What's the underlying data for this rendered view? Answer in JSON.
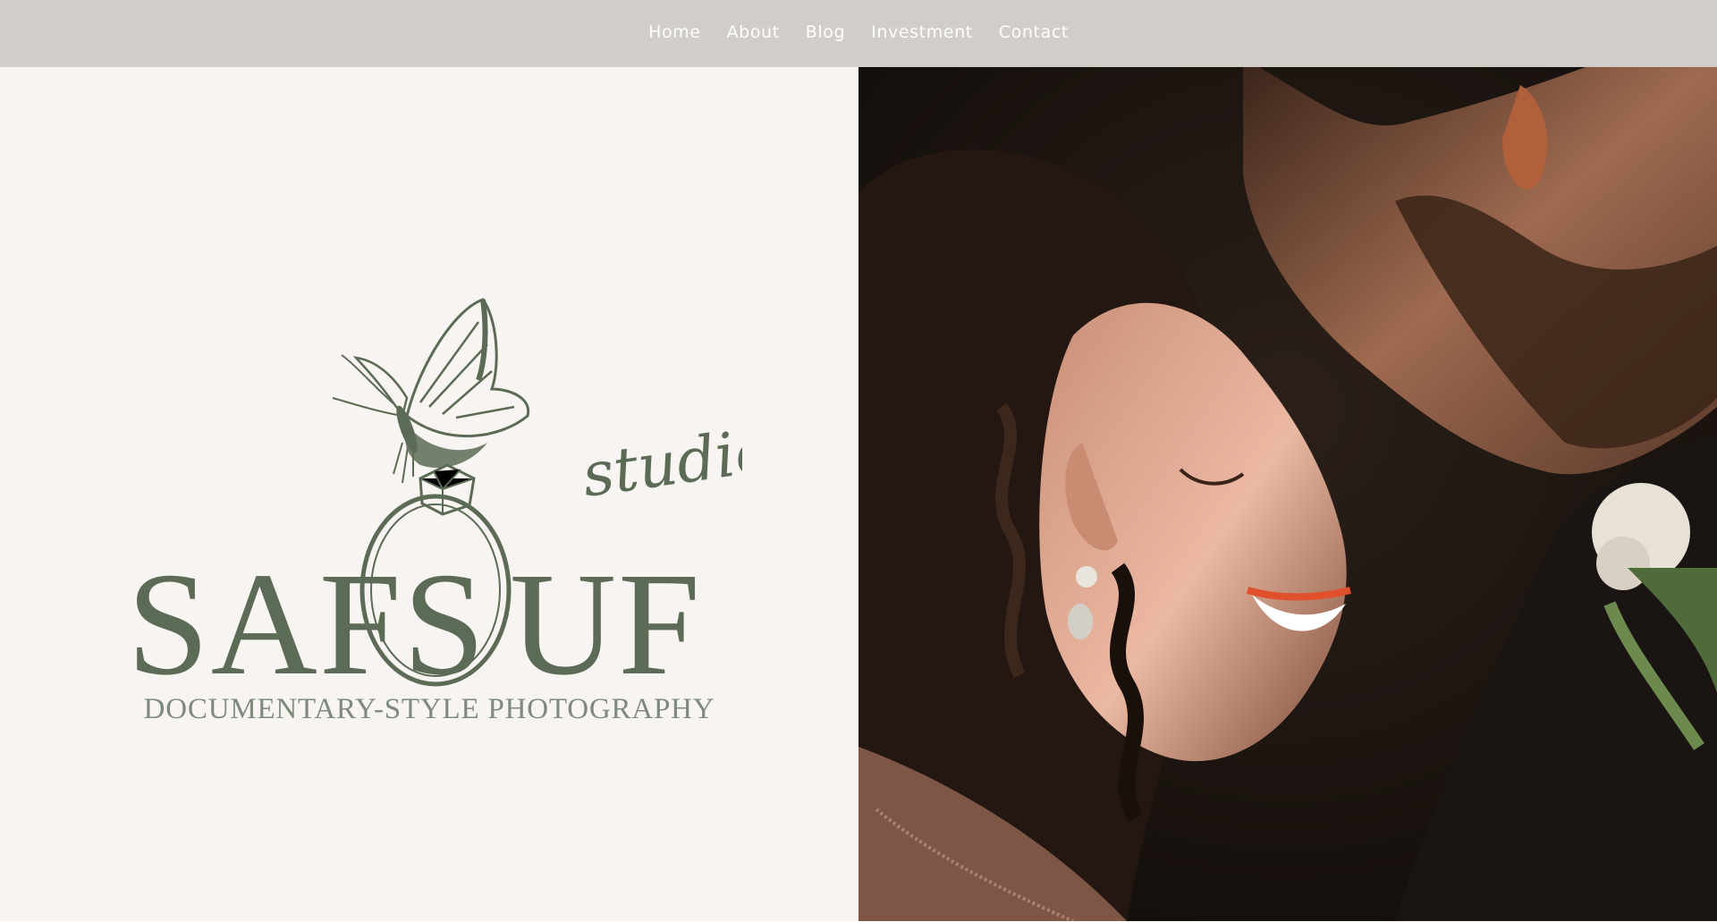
{
  "nav": {
    "items": [
      {
        "label": "Home"
      },
      {
        "label": "About"
      },
      {
        "label": "Blog"
      },
      {
        "label": "Investment"
      },
      {
        "label": "Contact"
      }
    ]
  },
  "brand": {
    "logo_wordmark": "SAFSOUF",
    "logo_script": "studio",
    "logo_icon": "butterfly-on-ring-icon",
    "tagline": "DOCUMENTARY-STYLE PHOTOGRAPHY",
    "color": "#5b6b55"
  },
  "hero": {
    "image": "couple-portrait-photo"
  },
  "colors": {
    "nav_background": "#d1cdc8",
    "panel_background": "#f7f4f1",
    "tagline": "#7e8a7c"
  }
}
